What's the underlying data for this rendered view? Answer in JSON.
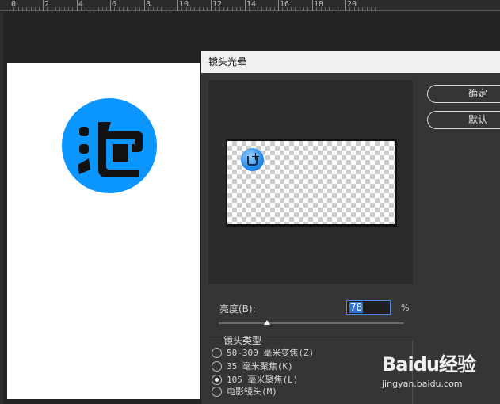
{
  "ruler": {
    "labels": [
      "0",
      "2",
      "4",
      "6",
      "8",
      "10",
      "12",
      "14",
      "16",
      "18",
      "20"
    ]
  },
  "dialog": {
    "title": "镜头光晕",
    "ok_label": "确定",
    "default_label": "默认",
    "brightness": {
      "label": "亮度(B):",
      "value": "78",
      "unit": "%",
      "level_percent": 78
    },
    "lens_type": {
      "title": "镜头类型",
      "options": [
        {
          "label": "50-300 毫米变焦(Z)",
          "checked": false
        },
        {
          "label": "35 毫米聚焦(K)",
          "checked": false
        },
        {
          "label": "105 毫米聚焦(L)",
          "checked": true
        },
        {
          "label": "电影镜头(M)",
          "checked": false
        }
      ]
    }
  },
  "canvas": {
    "logo_color": "#0b95ff"
  },
  "watermark": {
    "brand": "Baidu经验",
    "url": "jingyan.baidu.com"
  }
}
